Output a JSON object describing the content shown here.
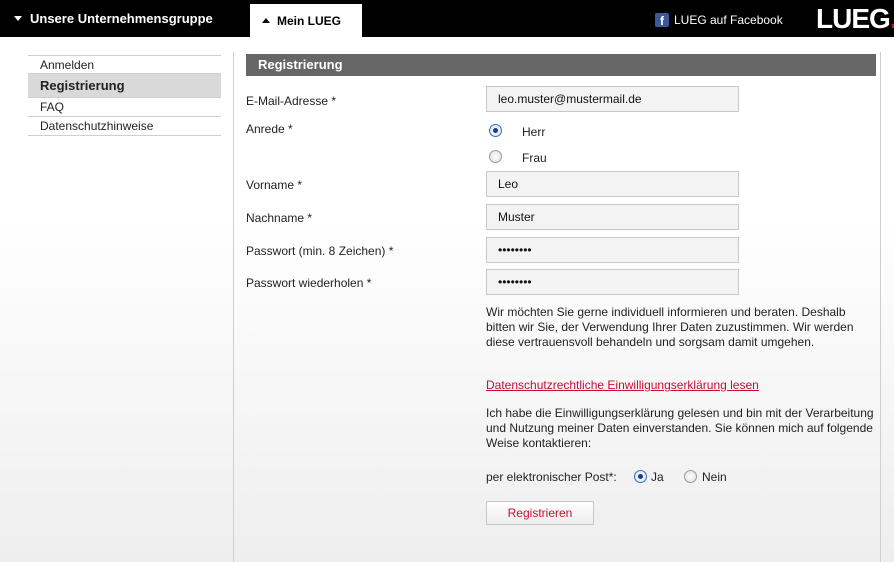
{
  "topbar": {
    "group_label": "Unsere Unternehmensgruppe",
    "mein_label": "Mein LUEG",
    "facebook_label": "LUEG auf Facebook",
    "facebook_icon_glyph": "f",
    "logo_text": "LUEG",
    "logo_dot": "."
  },
  "sidebar": {
    "items": [
      {
        "label": "Anmelden"
      },
      {
        "label": "Registrierung"
      },
      {
        "label": "FAQ"
      },
      {
        "label": "Datenschutzhinweise"
      }
    ]
  },
  "form": {
    "header": "Registrierung",
    "email_label": "E-Mail-Adresse *",
    "email_value": "leo.muster@mustermail.de",
    "anrede_label": "Anrede *",
    "anrede_options": [
      "Herr",
      "Frau"
    ],
    "vorname_label": "Vorname *",
    "vorname_value": "Leo",
    "nachname_label": "Nachname *",
    "nachname_value": "Muster",
    "passwort_label": "Passwort (min. 8 Zeichen) *",
    "passwort_value": "••••••••",
    "passwort2_label": "Passwort wiederholen *",
    "passwort2_value": "••••••••",
    "info_text": "Wir möchten Sie gerne individuell informieren und beraten. Deshalb bitten wir Sie, der Verwendung Ihrer Daten zuzustimmen. Wir werden diese vertrauensvoll behandeln und sorgsam damit umgehen.",
    "consent_link": "Datenschutzrechtliche Einwilligungserklärung lesen",
    "consent_text": "Ich habe die Einwilligungserklärung gelesen und bin mit der Verarbeitung und Nutzung meiner Daten einverstanden. Sie können mich auf folgende Weise kontaktieren:",
    "post_label": "per elektronischer Post*:",
    "post_options": [
      "Ja",
      "Nein"
    ],
    "submit_label": "Registrieren"
  },
  "colors": {
    "accent": "#c8102e",
    "header_bg": "#666666",
    "topbar_bg": "#000000",
    "facebook": "#3b5998"
  }
}
